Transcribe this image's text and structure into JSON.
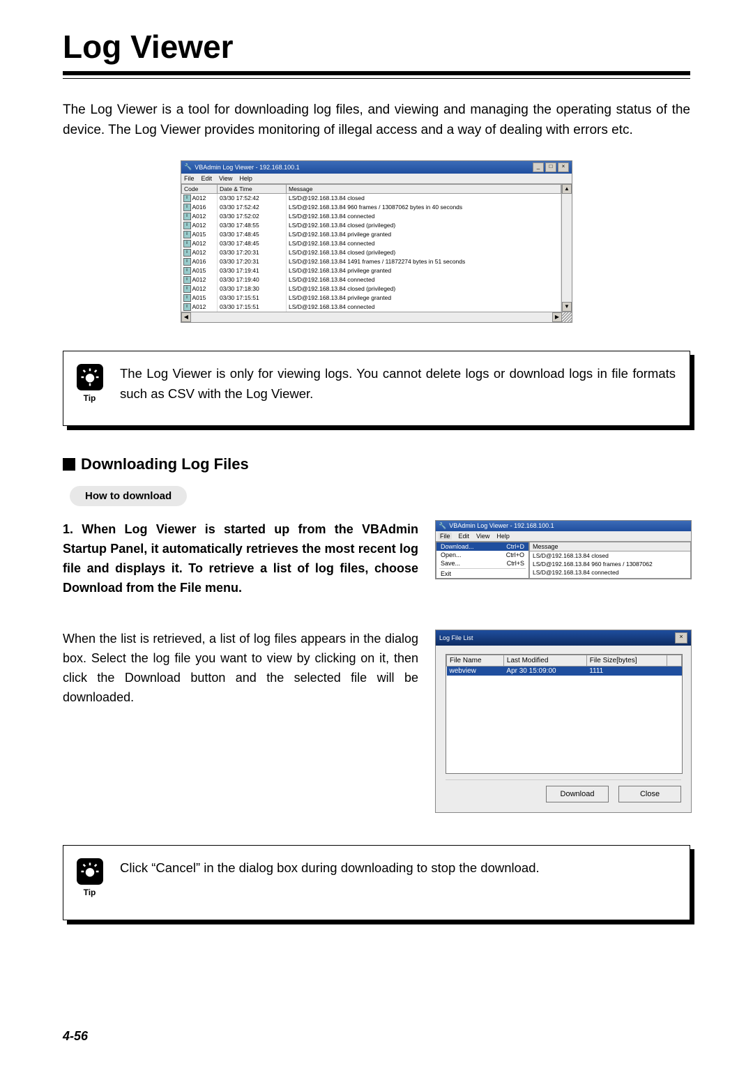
{
  "title": "Log Viewer",
  "intro": "The Log Viewer is a tool for downloading log files, and viewing and managing the operating status of the device. The Log Viewer provides monitoring of illegal access and a way of dealing with errors etc.",
  "page_number": "4-56",
  "main_window": {
    "title": "VBAdmin Log Viewer - 192.168.100.1",
    "menu": [
      "File",
      "Edit",
      "View",
      "Help"
    ],
    "columns": [
      "Code",
      "Date & Time",
      "Message"
    ],
    "rows": [
      {
        "code": "A012",
        "dt": "03/30 17:52:42",
        "msg": "LS/D@192.168.13.84 closed"
      },
      {
        "code": "A016",
        "dt": "03/30 17:52:42",
        "msg": "LS/D@192.168.13.84 960 frames / 13087062 bytes in 40 seconds"
      },
      {
        "code": "A012",
        "dt": "03/30 17:52:02",
        "msg": "LS/D@192.168.13.84 connected"
      },
      {
        "code": "A012",
        "dt": "03/30 17:48:55",
        "msg": "LS/D@192.168.13.84 closed (privileged)"
      },
      {
        "code": "A015",
        "dt": "03/30 17:48:45",
        "msg": "LS/D@192.168.13.84 privilege granted"
      },
      {
        "code": "A012",
        "dt": "03/30 17:48:45",
        "msg": "LS/D@192.168.13.84 connected"
      },
      {
        "code": "A012",
        "dt": "03/30 17:20:31",
        "msg": "LS/D@192.168.13.84 closed (privileged)"
      },
      {
        "code": "A016",
        "dt": "03/30 17:20:31",
        "msg": "LS/D@192.168.13.84 1491 frames / 11872274 bytes in 51 seconds"
      },
      {
        "code": "A015",
        "dt": "03/30 17:19:41",
        "msg": "LS/D@192.168.13.84 privilege granted"
      },
      {
        "code": "A012",
        "dt": "03/30 17:19:40",
        "msg": "LS/D@192.168.13.84 connected"
      },
      {
        "code": "A012",
        "dt": "03/30 17:18:30",
        "msg": "LS/D@192.168.13.84 closed (privileged)"
      },
      {
        "code": "A015",
        "dt": "03/30 17:15:51",
        "msg": "LS/D@192.168.13.84 privilege granted"
      },
      {
        "code": "A012",
        "dt": "03/30 17:15:51",
        "msg": "LS/D@192.168.13.84 connected"
      }
    ]
  },
  "tip1": {
    "label": "Tip",
    "text": "The Log Viewer is only for viewing logs. You cannot delete logs or download logs in file formats such as CSV with the Log Viewer."
  },
  "section_heading": "Downloading Log Files",
  "sub_heading": "How to download",
  "step1_text": "1. When Log Viewer is started up from the VBAdmin Startup Panel, it automatically retrieves the most recent log file and displays it. To retrieve a list of log files, choose Download from the File menu.",
  "step1_window": {
    "title": "VBAdmin Log Viewer - 192.168.100.1",
    "menu": [
      "File",
      "Edit",
      "View",
      "Help"
    ],
    "dropdown": [
      {
        "label": "Download...",
        "accel": "Ctrl+D",
        "hl": true
      },
      {
        "label": "Open...",
        "accel": "Ctrl+O"
      },
      {
        "label": "Save...",
        "accel": "Ctrl+S"
      },
      {
        "label": "Exit",
        "accel": ""
      }
    ],
    "msg_head": "Message",
    "msgs": [
      "LS/D@192.168.13.84 closed",
      "LS/D@192.168.13.84 960 frames / 13087062",
      "LS/D@192.168.13.84 connected"
    ]
  },
  "step2_text": "When the list is retrieved, a list of log files appears in the dialog box. Select the log file you want to view by clicking on it, then click the Download button and the selected file will be downloaded.",
  "dialog": {
    "title": "Log File List",
    "columns": [
      "File Name",
      "Last Modified",
      "File Size[bytes]"
    ],
    "row": {
      "name": "webview",
      "modified": "Apr 30 15:09:00",
      "size": "1111"
    },
    "btn_download": "Download",
    "btn_close": "Close"
  },
  "tip2": {
    "label": "Tip",
    "text": "Click “Cancel” in the dialog box during downloading to stop the download."
  }
}
